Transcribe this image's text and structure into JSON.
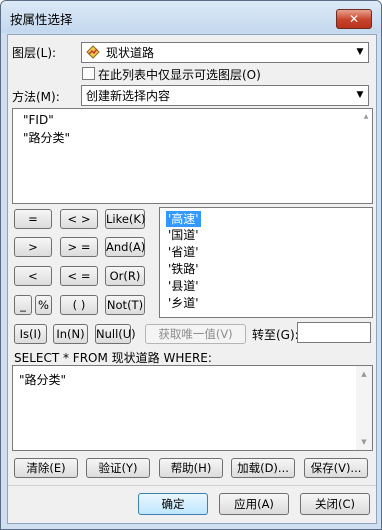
{
  "window": {
    "title": "按属性选择",
    "close_glyph": "✕"
  },
  "layer": {
    "label": "图层(L):",
    "value": "现状道路",
    "icon": "polyline-layer-icon",
    "checkbox_label": "在此列表中仅显示可选图层(O)",
    "checkbox_checked": false
  },
  "method": {
    "label": "方法(M):",
    "value": "创建新选择内容"
  },
  "fields": [
    "\"FID\"",
    "\"路分类\""
  ],
  "operators": {
    "eq": "=",
    "neq": "< >",
    "like": "Like(K)",
    "gt": ">",
    "gte": "> =",
    "and": "And(A)",
    "lt": "<",
    "lte": "< =",
    "or": "Or(R)",
    "underscore": "_",
    "percent": "%",
    "paren": "( )",
    "not": "Not(T)",
    "is": "Is(I)",
    "in": "In(N)",
    "null": "Null(U)"
  },
  "values": {
    "items": [
      "'高速'",
      "'国道'",
      "'省道'",
      "'铁路'",
      "'县道'",
      "'乡道'"
    ],
    "selected_index": 0
  },
  "get_unique": "获取唯一值(V)",
  "goto": {
    "label": "转至(G):",
    "value": ""
  },
  "sql": {
    "prefix": "SELECT * FROM 现状道路 WHERE:",
    "expression": "\"路分类\""
  },
  "actions": {
    "clear": "清除(E)",
    "verify": "验证(Y)",
    "help": "帮助(H)",
    "load": "加载(D)...",
    "save": "保存(V)..."
  },
  "footer": {
    "ok": "确定",
    "apply": "应用(A)",
    "close": "关闭(C)"
  },
  "colors": {
    "selection": "#3399ff",
    "title_bg": "#cfdff0",
    "close_red": "#c7432a"
  }
}
